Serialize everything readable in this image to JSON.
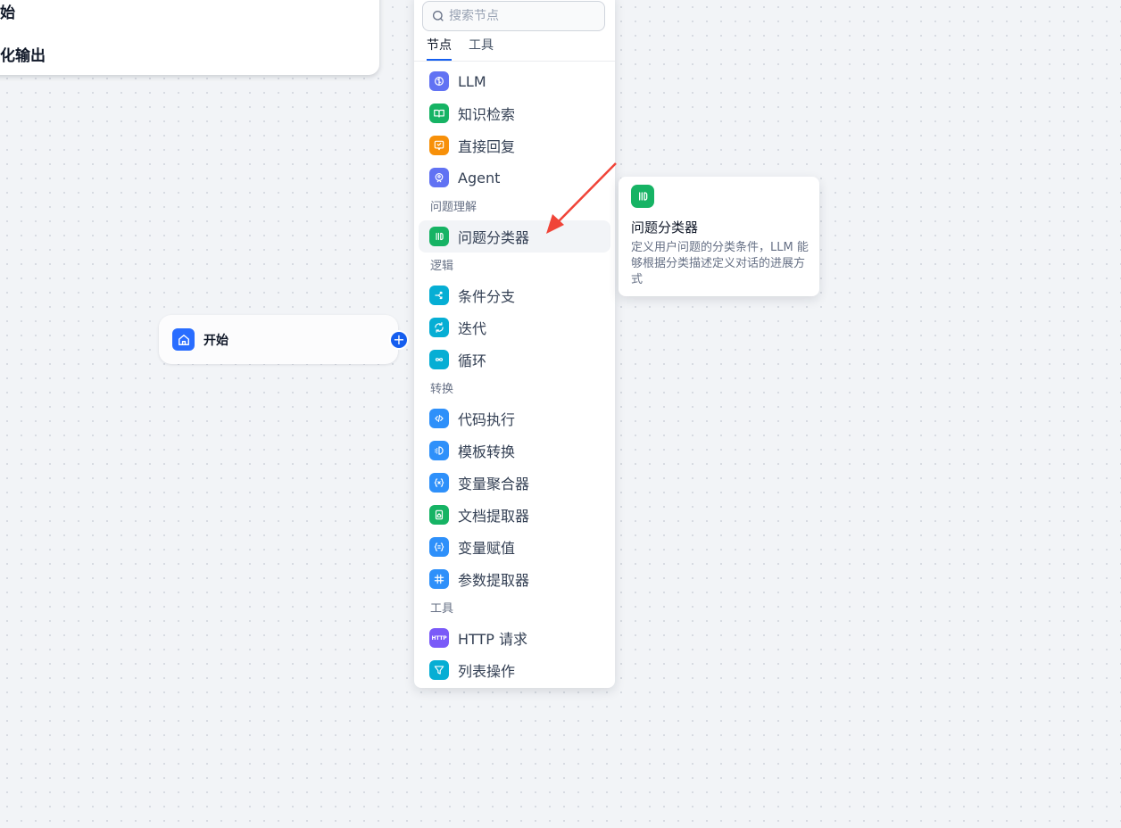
{
  "background_node": {
    "line1": "始",
    "line2": "化输出"
  },
  "start_node": {
    "label": "开始",
    "icon": "home-icon",
    "color": "#296dff"
  },
  "add_handle": {
    "label": "+"
  },
  "block_selector": {
    "search": {
      "placeholder": "搜索节点",
      "value": ""
    },
    "tabs": [
      {
        "label": "节点",
        "active": true
      },
      {
        "label": "工具",
        "active": false
      }
    ],
    "sections": [
      {
        "title": "",
        "items": [
          {
            "label": "LLM",
            "icon": "brain-icon",
            "color": "#6172f3"
          },
          {
            "label": "知识检索",
            "icon": "book-open-icon",
            "color": "#16b364"
          },
          {
            "label": "直接回复",
            "icon": "message-check-icon",
            "color": "#f79009"
          },
          {
            "label": "Agent",
            "icon": "agent-icon",
            "color": "#6172f3"
          }
        ]
      },
      {
        "title": "问题理解",
        "items": [
          {
            "label": "问题分类器",
            "icon": "classifier-icon",
            "color": "#16b364",
            "hovered": true
          }
        ]
      },
      {
        "title": "逻辑",
        "items": [
          {
            "label": "条件分支",
            "icon": "branch-icon",
            "color": "#06aed4"
          },
          {
            "label": "迭代",
            "icon": "refresh-icon",
            "color": "#06aed4"
          },
          {
            "label": "循环",
            "icon": "infinity-icon",
            "color": "#06aed4"
          }
        ]
      },
      {
        "title": "转换",
        "items": [
          {
            "label": "代码执行",
            "icon": "code-icon",
            "color": "#2e90fa"
          },
          {
            "label": "模板转换",
            "icon": "template-icon",
            "color": "#2e90fa"
          },
          {
            "label": "变量聚合器",
            "icon": "variable-icon",
            "color": "#2e90fa"
          },
          {
            "label": "文档提取器",
            "icon": "document-icon",
            "color": "#16b364"
          },
          {
            "label": "变量赋值",
            "icon": "assign-icon",
            "color": "#2e90fa"
          },
          {
            "label": "参数提取器",
            "icon": "parameter-icon",
            "color": "#2e90fa"
          }
        ]
      },
      {
        "title": "工具",
        "items": [
          {
            "label": "HTTP 请求",
            "icon": "http-icon",
            "color": "#7a5af8",
            "glyph": "HTTP"
          },
          {
            "label": "列表操作",
            "icon": "filter-icon",
            "color": "#06aed4"
          }
        ]
      }
    ]
  },
  "tooltip": {
    "title": "问题分类器",
    "description": "定义用户问题的分类条件，LLM 能够根据分类描述定义对话的进展方式",
    "icon": "classifier-icon",
    "color": "#16b364"
  },
  "annotation_arrow": {
    "color": "#f04438"
  }
}
